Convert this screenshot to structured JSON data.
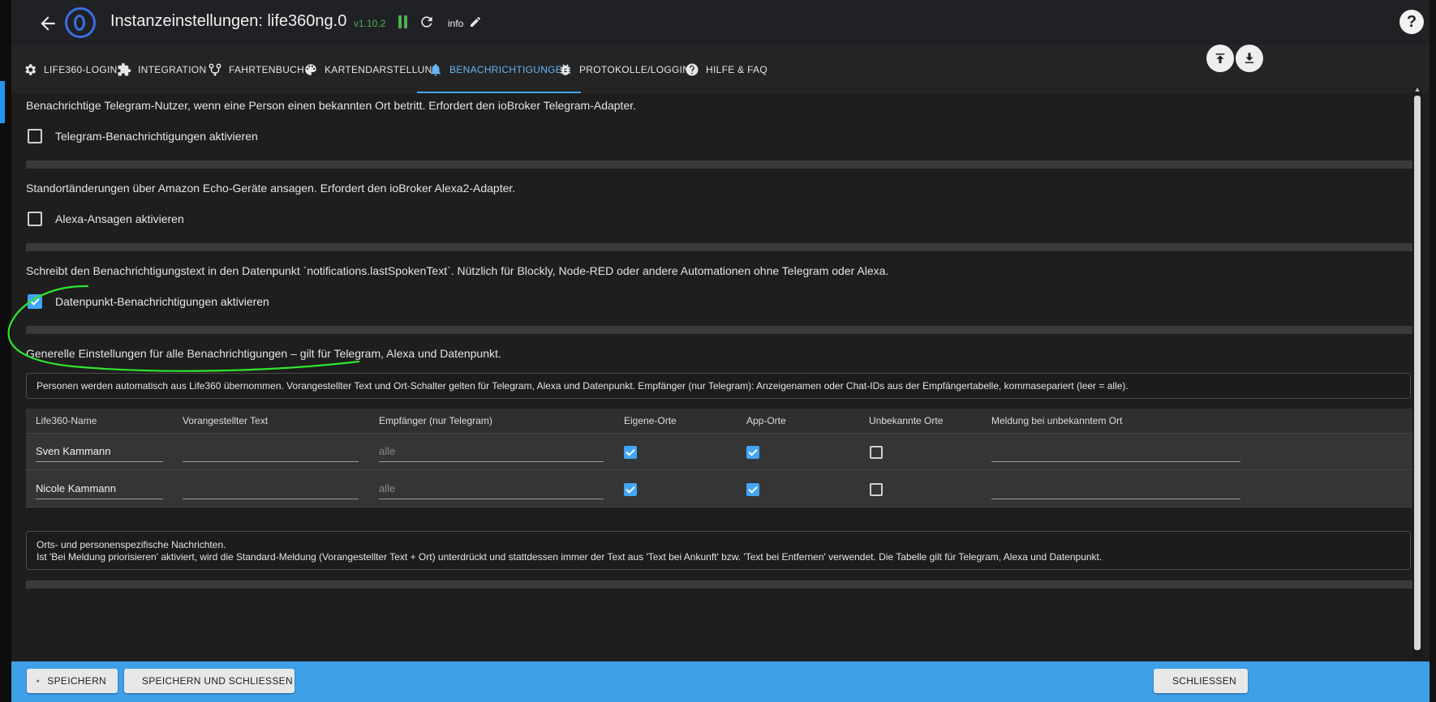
{
  "header": {
    "title": "Instanzeinstellungen: life360ng.0",
    "version": "v1.10.2",
    "info_label": "info",
    "help_label": "?",
    "icons": {
      "back": "arrow-left-icon",
      "pause": "pause-icon",
      "reload": "reload-icon",
      "edit": "pencil-icon",
      "help": "help-icon"
    }
  },
  "tabs": [
    {
      "label": "LIFE360-LOGIN",
      "icon": "gear-icon"
    },
    {
      "label": "INTEGRATION",
      "icon": "puzzle-icon"
    },
    {
      "label": "FAHRTENBUCH",
      "icon": "route-icon"
    },
    {
      "label": "KARTENDARSTELLUNG",
      "icon": "palette-icon"
    },
    {
      "label": "BENACHRICHTIGUNGEN",
      "icon": "bell-icon",
      "active": true
    },
    {
      "label": "PROTOKOLLE/LOGGING",
      "icon": "bug-icon"
    },
    {
      "label": "HILFE & FAQ",
      "icon": "help-circle-icon"
    }
  ],
  "sections": {
    "telegram": {
      "description": "Benachrichtige Telegram-Nutzer, wenn eine Person einen bekannten Ort betritt. Erfordert den ioBroker Telegram-Adapter.",
      "checkbox_label": "Telegram-Benachrichtigungen aktivieren",
      "checked": false
    },
    "alexa": {
      "description": "Standortänderungen über Amazon Echo-Geräte ansagen. Erfordert den ioBroker Alexa2-Adapter.",
      "checkbox_label": "Alexa-Ansagen aktivieren",
      "checked": false
    },
    "datapoint": {
      "description": "Schreibt den Benachrichtigungstext in den Datenpunkt `notifications.lastSpokenText`. Nützlich für Blockly, Node-RED oder andere Automationen ohne Telegram oder Alexa.",
      "checkbox_label": "Datenpunkt-Benachrichtigungen aktivieren",
      "checked": true
    },
    "general": {
      "description": "Generelle Einstellungen für alle Benachrichtigungen – gilt für Telegram, Alexa und Datenpunkt.",
      "note": "Personen werden automatisch aus Life360 übernommen. Vorangestellter Text und Ort-Schalter gelten für Telegram, Alexa und Datenpunkt. Empfänger (nur Telegram): Anzeigenamen oder Chat-IDs aus der Empfängertabelle, kommasepariert (leer = alle)."
    },
    "places": {
      "note_line1": "Orts- und personenspezifische Nachrichten.",
      "note_line2": "Ist 'Bei Meldung priorisieren' aktiviert, wird die Standard-Meldung (Vorangestellter Text + Ort) unterdrückt und stattdessen immer der Text aus 'Text bei Ankunft' bzw. 'Text bei Entfernen' verwendet. Die Tabelle gilt für Telegram, Alexa und Datenpunkt."
    }
  },
  "table": {
    "columns": [
      "Life360-Name",
      "Vorangestellter Text",
      "Empfänger (nur Telegram)",
      "Eigene-Orte",
      "App-Orte",
      "Unbekannte Orte",
      "Meldung bei unbekanntem Ort"
    ],
    "rows": [
      {
        "name": "Sven Kammann",
        "prefix": "",
        "recipients_placeholder": "alle",
        "own_places": true,
        "app_places": true,
        "unknown_places": false,
        "unknown_message": ""
      },
      {
        "name": "Nicole Kammann",
        "prefix": "",
        "recipients_placeholder": "alle",
        "own_places": true,
        "app_places": true,
        "unknown_places": false,
        "unknown_message": ""
      }
    ]
  },
  "footer": {
    "save_label": "SPEICHERN",
    "save_close_label": "SPEICHERN UND SCHLIESSEN",
    "close_label": "SCHLIESSEN"
  },
  "colors": {
    "accent": "#42a5f5",
    "footer_bar": "#3fa0ea",
    "version_text": "#4caf50",
    "annotation_stroke": "#2fe62f"
  }
}
